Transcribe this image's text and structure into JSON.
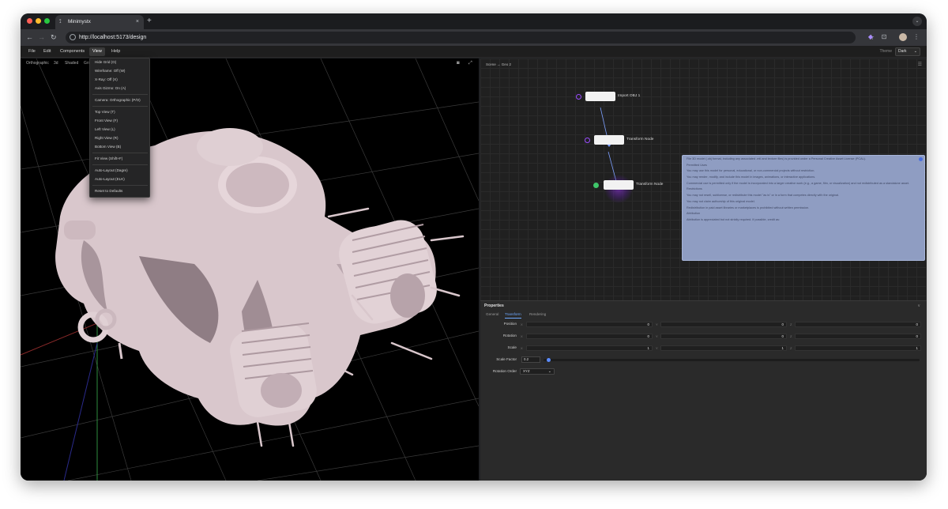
{
  "browser": {
    "tab_title": "Minimystx",
    "tab_close": "×",
    "new_tab": "+",
    "url": "http://localhost:5173/design"
  },
  "app_menu": {
    "items": [
      "File",
      "Edit",
      "Components",
      "View",
      "Help"
    ],
    "active": "View",
    "theme_label": "Theme",
    "theme_value": "Dark"
  },
  "viewport": {
    "toolbar": [
      "Orthographic",
      "3d",
      "Shaded",
      "Grid"
    ],
    "screenshot_icon": "camera-icon",
    "fullscreen_icon": "expand-icon"
  },
  "view_menu": {
    "groups": [
      [
        "Hide Grid (G)",
        "Wireframe: Off (W)",
        "X-Ray: Off (X)",
        "Axis Gizmo: On (A)"
      ],
      [
        "Camera: Orthographic (P/O)"
      ],
      [
        "Top View (T)",
        "Front View (F)",
        "Left View (L)",
        "Right View (R)",
        "Bottom View (B)"
      ],
      [
        "Fit View (Shift+F)"
      ],
      [
        "Auto-Layout (Dagre)",
        "Auto-Layout (ELK)"
      ],
      [
        "Reset to Defaults"
      ]
    ]
  },
  "graph": {
    "breadcrumb": "Scene  →  Geo 2",
    "nodes": [
      {
        "label": "Import OBJ 1"
      },
      {
        "label": "Transform Node"
      },
      {
        "label": "Transform Node"
      }
    ],
    "license": [
      "File 3D model (.obj format, including any associated .mtl and texture files) is provided under a Personal Creative Asset License (PCAL).",
      "Permitted Uses",
      "You may use this model for personal, educational, or non-commercial projects without restriction.",
      "You may render, modify, and include this model in images, animations, or interactive applications.",
      "Commercial use is permitted only if the model is incorporated into a larger creative work (e.g., a game, film, or visualization) and not redistributed as a standalone asset.",
      "Restrictions",
      "You may not resell, sublicense, or redistribute this model \"as is\" or in a form that competes directly with the original.",
      "You may not claim authorship of this original model.",
      "Redistribution in paid asset libraries or marketplaces is prohibited without written permission.",
      "Attribution",
      "Attribution is appreciated but not strictly required. If possible, credit as:"
    ]
  },
  "properties": {
    "title": "Properties",
    "collapse": "∨",
    "tabs": [
      "General",
      "Transform",
      "Rendering"
    ],
    "active_tab": "Transform",
    "rows": [
      {
        "label": "Position",
        "x": "0",
        "y": "0",
        "z": "0"
      },
      {
        "label": "Rotation",
        "x": "0",
        "y": "0",
        "z": "0"
      },
      {
        "label": "Scale",
        "x": "1",
        "y": "1",
        "z": "1"
      }
    ],
    "axes": [
      "X",
      "Y",
      "Z"
    ],
    "scale_factor_label": "Scale Factor",
    "scale_factor_value": "0.2",
    "scale_factor_level": 0.01,
    "rotation_order_label": "Rotation Order",
    "rotation_order_value": "XYZ"
  },
  "colors": {
    "accent": "#6ea8ff",
    "node_port": "#9b4dff",
    "output_port": "#3fc66a",
    "license_bg": "#8f9dc2",
    "model": "#d9c7cc"
  }
}
